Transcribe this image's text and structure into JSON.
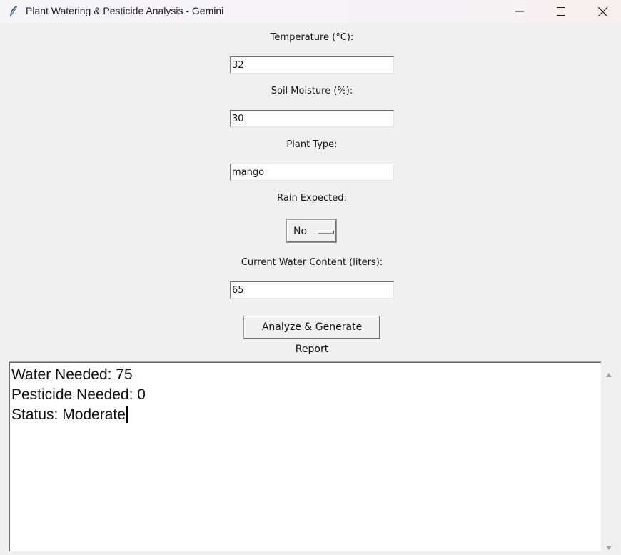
{
  "window": {
    "title": "Plant Watering & Pesticide Analysis - Gemini"
  },
  "form": {
    "temperature_label": "Temperature (°C):",
    "temperature_value": "32",
    "soil_moisture_label": "Soil Moisture (%):",
    "soil_moisture_value": "30",
    "plant_type_label": "Plant Type:",
    "plant_type_value": "mango",
    "rain_label": "Rain Expected:",
    "rain_value": "No",
    "water_content_label": "Current Water Content (liters):",
    "water_content_value": "65",
    "analyze_button_label": "Analyze & Generate Report"
  },
  "report": {
    "lines": [
      "Water Needed: 75",
      "Pesticide Needed: 0",
      "Status: Moderate"
    ]
  },
  "icons": {
    "app": "feather-icon",
    "minimize": "minimize-icon",
    "maximize": "maximize-icon",
    "close": "close-icon",
    "scroll_up": "scroll-up-arrow-icon",
    "scroll_down": "scroll-down-arrow-icon"
  }
}
